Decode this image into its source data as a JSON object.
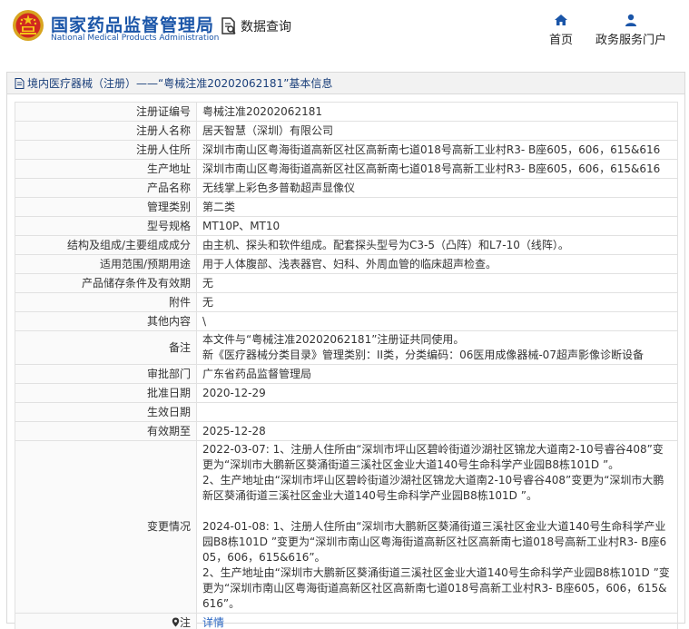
{
  "header": {
    "site_name": "国家药品监督管理局",
    "site_name_en": "National Medical Products Administration",
    "query_label": "数据查询",
    "nav": {
      "home": "首页",
      "gov_portal": "政务服务门户"
    }
  },
  "panel": {
    "title": "境内医疗器械（注册）——“粤械注准20202062181”基本信息"
  },
  "record": {
    "registration_no": {
      "label": "注册证编号",
      "value": "粤械注准20202062181"
    },
    "registrant_name": {
      "label": "注册人名称",
      "value": "居天智慧（深圳）有限公司"
    },
    "registrant_address": {
      "label": "注册人住所",
      "value": "深圳市南山区粤海街道高新区社区高新南七道018号高新工业村R3- B座605，606，615&616"
    },
    "production_address": {
      "label": "生产地址",
      "value": "深圳市南山区粤海街道高新区社区高新南七道018号高新工业村R3- B座605，606，615&616"
    },
    "product_name": {
      "label": "产品名称",
      "value": "无线掌上彩色多普勒超声显像仪"
    },
    "management_class": {
      "label": "管理类别",
      "value": "第二类"
    },
    "model_spec": {
      "label": "型号规格",
      "value": "MT10P、MT10"
    },
    "structure": {
      "label": "结构及组成/主要组成成分",
      "value": "由主机、探头和软件组成。配套探头型号为C3-5（凸阵）和L7-10（线阵）。"
    },
    "scope": {
      "label": "适用范围/预期用途",
      "value": "用于人体腹部、浅表器官、妇科、外周血管的临床超声检查。"
    },
    "storage": {
      "label": "产品储存条件及有效期",
      "value": "无"
    },
    "attachment": {
      "label": "附件",
      "value": "无"
    },
    "other": {
      "label": "其他内容",
      "value": "\\"
    },
    "remarks": {
      "label": "备注",
      "line1": "本文件与“粤械注准20202062181”注册证共同使用。",
      "line2": "新《医疗器械分类目录》管理类别：II类，分类编码：06医用成像器械-07超声影像诊断设备"
    },
    "approval_dept": {
      "label": "审批部门",
      "value": "广东省药品监督管理局"
    },
    "approval_date": {
      "label": "批准日期",
      "value": "2020-12-29"
    },
    "effective_date": {
      "label": "生效日期",
      "value": ""
    },
    "valid_until": {
      "label": "有效期至",
      "value": "2025-12-28"
    },
    "changes": {
      "label": "变更情况",
      "entry1_line1": "2022-03-07: 1、注册人住所由“深圳市坪山区碧岭街道沙湖社区锦龙大道南2-10号睿谷408”变更为“深圳市大鹏新区葵涌街道三溪社区金业大道140号生命科学产业园B8栋101D ”。",
      "entry1_line2": "2、生产地址由“深圳市坪山区碧岭街道沙湖社区锦龙大道南2-10号睿谷408”变更为“深圳市大鹏新区葵涌街道三溪社区金业大道140号生命科学产业园B8栋101D ”。",
      "entry2_line1": "2024-01-08: 1、注册人住所由“深圳市大鹏新区葵涌街道三溪社区金业大道140号生命科学产业园B8栋101D ”变更为“深圳市南山区粤海街道高新区社区高新南七道018号高新工业村R3- B座605，606，615&616”。",
      "entry2_line2": "2、生产地址由“深圳市大鹏新区葵涌街道三溪社区金业大道140号生命科学产业园B8栋101D ”变更为“深圳市南山区粤海街道高新区社区高新南七道018号高新工业村R3- B座605，606，615&616”。"
    },
    "note": {
      "label": "注",
      "link": "详情"
    }
  },
  "icons": {
    "emblem": "national-emblem-icon",
    "query": "document-search-icon",
    "home": "home-icon",
    "gov": "user-icon",
    "title": "document-icon",
    "note": "location-pin-icon"
  },
  "colors": {
    "brand": "#1a55a8",
    "link": "#2a66c2",
    "panel_title": "#1a3f7a",
    "border": "#e1e1e1"
  }
}
